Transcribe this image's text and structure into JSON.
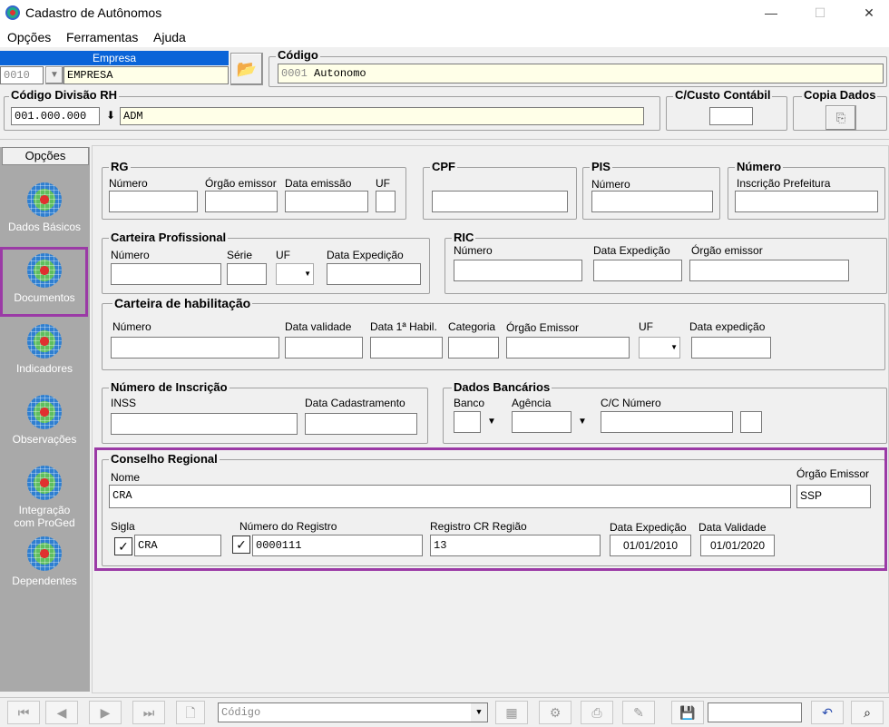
{
  "window": {
    "title": "Cadastro de Autônomos",
    "controls": {
      "minimize": "—",
      "maximize": "☐",
      "close": "✕"
    }
  },
  "menu": [
    "Opções",
    "Ferramentas",
    "Ajuda"
  ],
  "empresa": {
    "header": "Empresa",
    "code": "0010",
    "name": "EMPRESA"
  },
  "codigo": {
    "label": "Código",
    "code": "0001",
    "name": "Autonomo"
  },
  "divisao": {
    "label": "Código Divisão RH",
    "code": "001.000.000",
    "name": "ADM"
  },
  "custo": {
    "label": "C/Custo Contábil",
    "value": ""
  },
  "copia": {
    "label": "Copia Dados"
  },
  "sidebar": {
    "header": "Opções",
    "items": [
      "Dados Básicos",
      "Documentos",
      "Indicadores",
      "Observações",
      "Integração com ProGed",
      "Dependentes"
    ],
    "selected": 1
  },
  "rg": {
    "title": "RG",
    "numero": "Número",
    "orgao": "Órgão emissor",
    "data": "Data emissão",
    "uf": "UF"
  },
  "cpf": {
    "title": "CPF"
  },
  "pis": {
    "title": "PIS",
    "numero": "Número"
  },
  "numero": {
    "title": "Número",
    "inscricao": "Inscrição Prefeitura"
  },
  "carteira": {
    "title": "Carteira Profissional",
    "numero": "Número",
    "serie": "Série",
    "uf": "UF",
    "data": "Data Expedição"
  },
  "ric": {
    "title": "RIC",
    "numero": "Número",
    "data": "Data Expedição",
    "orgao": "Órgão emissor"
  },
  "habilitacao": {
    "title": "Carteira de habilitação",
    "numero": "Número",
    "validade": "Data validade",
    "primeira": "Data 1ª Habil.",
    "categoria": "Categoria",
    "orgao": "Órgão Emissor",
    "uf": "UF",
    "expedicao": "Data expedição"
  },
  "inscricao": {
    "title": "Número de Inscrição",
    "inss": "INSS",
    "data": "Data Cadastramento"
  },
  "bancarios": {
    "title": "Dados Bancários",
    "banco": "Banco",
    "agencia": "Agência",
    "conta": "C/C Número"
  },
  "conselho": {
    "title": "Conselho Regional",
    "nome_label": "Nome",
    "nome": "CRA",
    "orgao_label": "Órgão Emissor",
    "orgao": "SSP",
    "sigla_label": "Sigla",
    "sigla": "CRA",
    "sigla_checked": true,
    "registro_label": "Número do Registro",
    "registro": "0000111",
    "registro_checked": true,
    "regiao_label": "Registro CR Região",
    "regiao": "13",
    "expedicao_label": "Data Expedição",
    "expedicao": "01/01/2010",
    "validade_label": "Data Validade",
    "validade": "01/01/2020"
  },
  "toolbar": {
    "search_placeholder": "Código",
    "search_value": ""
  }
}
